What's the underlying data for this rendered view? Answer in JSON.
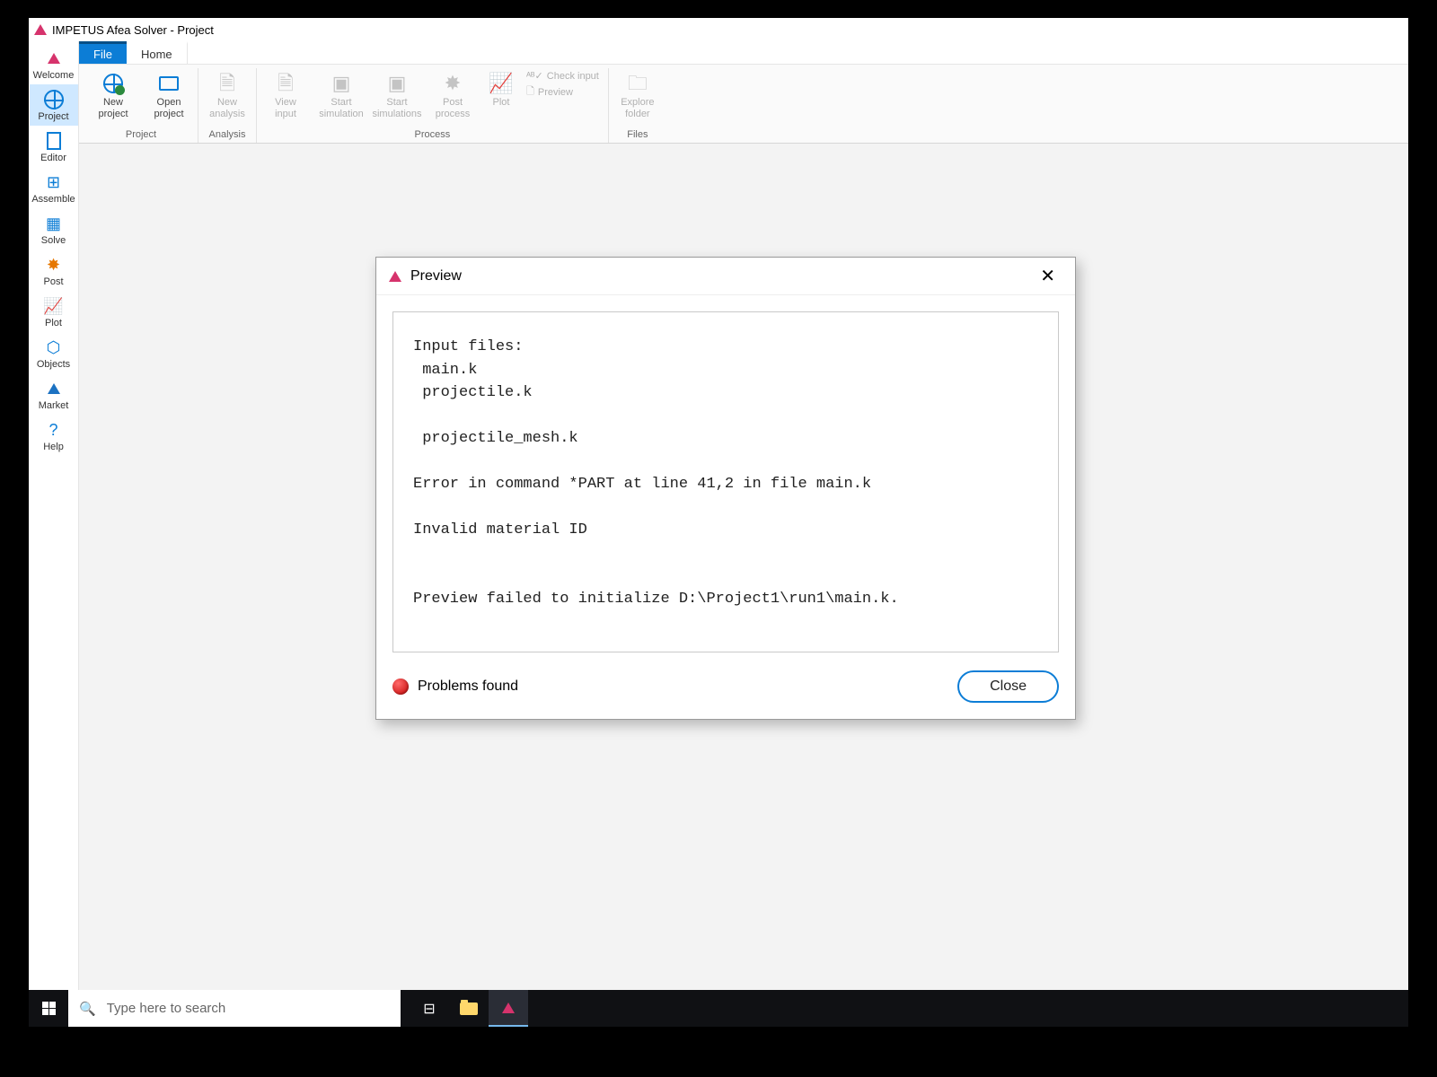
{
  "window": {
    "title": "IMPETUS Afea Solver - Project"
  },
  "left_rail": {
    "items": [
      {
        "label": "Welcome"
      },
      {
        "label": "Project"
      },
      {
        "label": "Editor"
      },
      {
        "label": "Assemble"
      },
      {
        "label": "Solve"
      },
      {
        "label": "Post"
      },
      {
        "label": "Plot"
      },
      {
        "label": "Objects"
      },
      {
        "label": "Market"
      },
      {
        "label": "Help"
      }
    ]
  },
  "ribbon_tabs": {
    "file": "File",
    "home": "Home"
  },
  "ribbon": {
    "project": {
      "label": "Project",
      "new_project": "New\nproject",
      "open_project": "Open\nproject"
    },
    "analysis": {
      "label": "Analysis",
      "new_analysis": "New\nanalysis"
    },
    "process": {
      "label": "Process",
      "view_input": "View\ninput",
      "start_simulation": "Start\nsimulation",
      "start_simulations": "Start\nsimulations",
      "post_process": "Post\nprocess",
      "plot": "Plot",
      "check_input": "Check input",
      "preview": "Preview"
    },
    "files": {
      "label": "Files",
      "explore_folder": "Explore\nfolder"
    }
  },
  "dialog": {
    "title": "Preview",
    "console": "Input files:\n main.k\n projectile.k\n\n projectile_mesh.k\n\nError in command *PART at line 41,2 in file main.k\n\nInvalid material ID\n\n\nPreview failed to initialize D:\\Project1\\run1\\main.k.",
    "status": "Problems found",
    "close": "Close"
  },
  "taskbar": {
    "search_placeholder": "Type here to search"
  }
}
